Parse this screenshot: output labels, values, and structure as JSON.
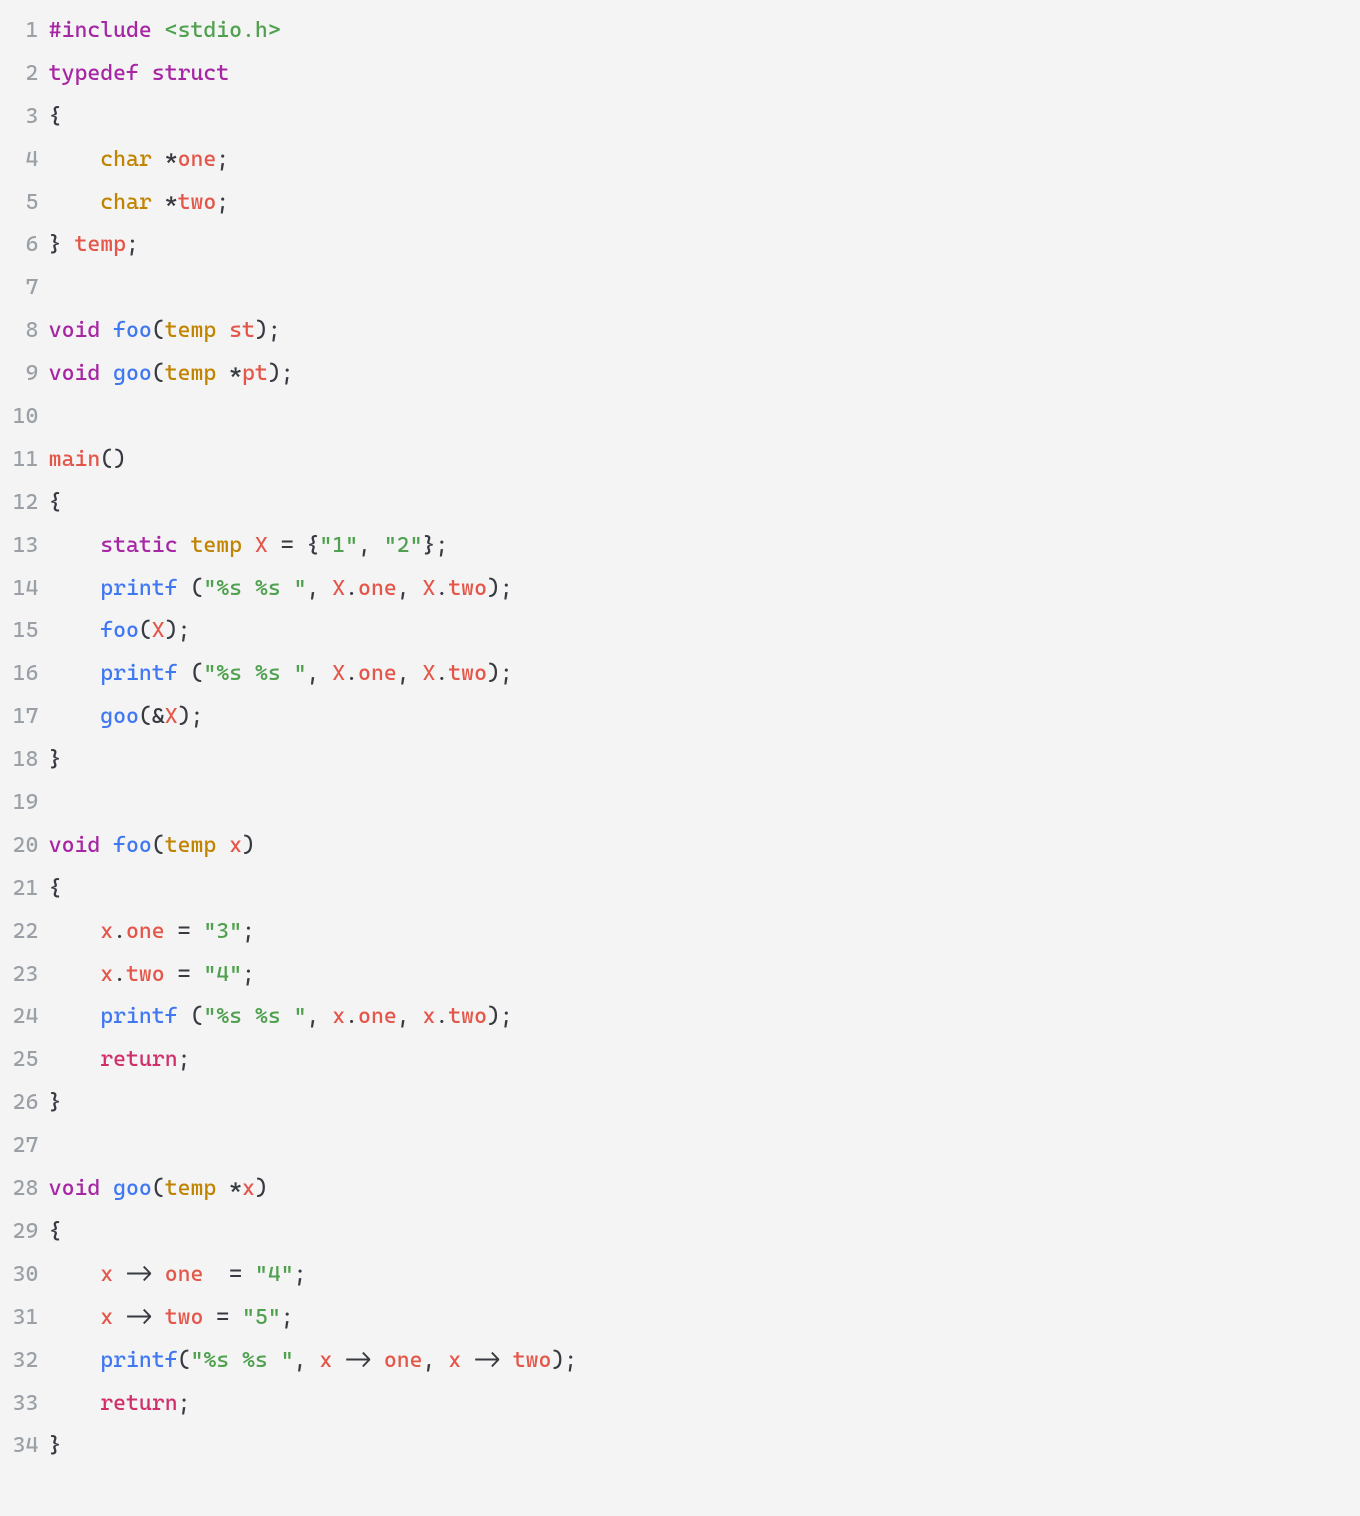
{
  "code": {
    "lines": [
      {
        "n": "1",
        "tokens": [
          {
            "c": "pre",
            "t": "#include "
          },
          {
            "c": "inc",
            "t": "<stdio.h>"
          }
        ]
      },
      {
        "n": "2",
        "tokens": [
          {
            "c": "kw",
            "t": "typedef"
          },
          {
            "c": "txt",
            "t": " "
          },
          {
            "c": "kw",
            "t": "struct"
          }
        ]
      },
      {
        "n": "3",
        "tokens": [
          {
            "c": "pun",
            "t": "{"
          }
        ]
      },
      {
        "n": "4",
        "tokens": [
          {
            "c": "txt",
            "t": "    "
          },
          {
            "c": "type",
            "t": "char"
          },
          {
            "c": "txt",
            "t": " *"
          },
          {
            "c": "name",
            "t": "one"
          },
          {
            "c": "pun",
            "t": ";"
          }
        ]
      },
      {
        "n": "5",
        "tokens": [
          {
            "c": "txt",
            "t": "    "
          },
          {
            "c": "type",
            "t": "char"
          },
          {
            "c": "txt",
            "t": " *"
          },
          {
            "c": "name",
            "t": "two"
          },
          {
            "c": "pun",
            "t": ";"
          }
        ]
      },
      {
        "n": "6",
        "tokens": [
          {
            "c": "pun",
            "t": "} "
          },
          {
            "c": "name",
            "t": "temp"
          },
          {
            "c": "pun",
            "t": ";"
          }
        ]
      },
      {
        "n": "7",
        "tokens": []
      },
      {
        "n": "8",
        "tokens": [
          {
            "c": "kw",
            "t": "void"
          },
          {
            "c": "txt",
            "t": " "
          },
          {
            "c": "func",
            "t": "foo"
          },
          {
            "c": "pun",
            "t": "("
          },
          {
            "c": "type",
            "t": "temp"
          },
          {
            "c": "txt",
            "t": " "
          },
          {
            "c": "name",
            "t": "st"
          },
          {
            "c": "pun",
            "t": ");"
          }
        ]
      },
      {
        "n": "9",
        "tokens": [
          {
            "c": "kw",
            "t": "void"
          },
          {
            "c": "txt",
            "t": " "
          },
          {
            "c": "func",
            "t": "goo"
          },
          {
            "c": "pun",
            "t": "("
          },
          {
            "c": "type",
            "t": "temp"
          },
          {
            "c": "txt",
            "t": " *"
          },
          {
            "c": "name",
            "t": "pt"
          },
          {
            "c": "pun",
            "t": ");"
          }
        ]
      },
      {
        "n": "10",
        "tokens": []
      },
      {
        "n": "11",
        "tokens": [
          {
            "c": "name",
            "t": "main"
          },
          {
            "c": "pun",
            "t": "()"
          }
        ]
      },
      {
        "n": "12",
        "tokens": [
          {
            "c": "pun",
            "t": "{"
          }
        ]
      },
      {
        "n": "13",
        "tokens": [
          {
            "c": "txt",
            "t": "    "
          },
          {
            "c": "kw",
            "t": "static"
          },
          {
            "c": "txt",
            "t": " "
          },
          {
            "c": "type",
            "t": "temp"
          },
          {
            "c": "txt",
            "t": " "
          },
          {
            "c": "name",
            "t": "X"
          },
          {
            "c": "txt",
            "t": " = {"
          },
          {
            "c": "str",
            "t": "\"1\""
          },
          {
            "c": "pun",
            "t": ", "
          },
          {
            "c": "str",
            "t": "\"2\""
          },
          {
            "c": "pun",
            "t": "};"
          }
        ]
      },
      {
        "n": "14",
        "tokens": [
          {
            "c": "txt",
            "t": "    "
          },
          {
            "c": "func",
            "t": "printf"
          },
          {
            "c": "txt",
            "t": " ("
          },
          {
            "c": "str",
            "t": "\"%s %s \""
          },
          {
            "c": "pun",
            "t": ", "
          },
          {
            "c": "name",
            "t": "X"
          },
          {
            "c": "pun",
            "t": "."
          },
          {
            "c": "name",
            "t": "one"
          },
          {
            "c": "pun",
            "t": ", "
          },
          {
            "c": "name",
            "t": "X"
          },
          {
            "c": "pun",
            "t": "."
          },
          {
            "c": "name",
            "t": "two"
          },
          {
            "c": "pun",
            "t": ");"
          }
        ]
      },
      {
        "n": "15",
        "tokens": [
          {
            "c": "txt",
            "t": "    "
          },
          {
            "c": "func",
            "t": "foo"
          },
          {
            "c": "pun",
            "t": "("
          },
          {
            "c": "name",
            "t": "X"
          },
          {
            "c": "pun",
            "t": ");"
          }
        ]
      },
      {
        "n": "16",
        "tokens": [
          {
            "c": "txt",
            "t": "    "
          },
          {
            "c": "func",
            "t": "printf"
          },
          {
            "c": "txt",
            "t": " ("
          },
          {
            "c": "str",
            "t": "\"%s %s \""
          },
          {
            "c": "pun",
            "t": ", "
          },
          {
            "c": "name",
            "t": "X"
          },
          {
            "c": "pun",
            "t": "."
          },
          {
            "c": "name",
            "t": "one"
          },
          {
            "c": "pun",
            "t": ", "
          },
          {
            "c": "name",
            "t": "X"
          },
          {
            "c": "pun",
            "t": "."
          },
          {
            "c": "name",
            "t": "two"
          },
          {
            "c": "pun",
            "t": ");"
          }
        ]
      },
      {
        "n": "17",
        "tokens": [
          {
            "c": "txt",
            "t": "    "
          },
          {
            "c": "func",
            "t": "goo"
          },
          {
            "c": "pun",
            "t": "(&"
          },
          {
            "c": "name",
            "t": "X"
          },
          {
            "c": "pun",
            "t": ");"
          }
        ]
      },
      {
        "n": "18",
        "tokens": [
          {
            "c": "pun",
            "t": "}"
          }
        ]
      },
      {
        "n": "19",
        "tokens": []
      },
      {
        "n": "20",
        "tokens": [
          {
            "c": "kw",
            "t": "void"
          },
          {
            "c": "txt",
            "t": " "
          },
          {
            "c": "func",
            "t": "foo"
          },
          {
            "c": "pun",
            "t": "("
          },
          {
            "c": "type",
            "t": "temp"
          },
          {
            "c": "txt",
            "t": " "
          },
          {
            "c": "name",
            "t": "x"
          },
          {
            "c": "pun",
            "t": ")"
          }
        ]
      },
      {
        "n": "21",
        "tokens": [
          {
            "c": "pun",
            "t": "{"
          }
        ]
      },
      {
        "n": "22",
        "tokens": [
          {
            "c": "txt",
            "t": "    "
          },
          {
            "c": "name",
            "t": "x"
          },
          {
            "c": "pun",
            "t": "."
          },
          {
            "c": "name",
            "t": "one"
          },
          {
            "c": "txt",
            "t": " = "
          },
          {
            "c": "str",
            "t": "\"3\""
          },
          {
            "c": "pun",
            "t": ";"
          }
        ]
      },
      {
        "n": "23",
        "tokens": [
          {
            "c": "txt",
            "t": "    "
          },
          {
            "c": "name",
            "t": "x"
          },
          {
            "c": "pun",
            "t": "."
          },
          {
            "c": "name",
            "t": "two"
          },
          {
            "c": "txt",
            "t": " = "
          },
          {
            "c": "str",
            "t": "\"4\""
          },
          {
            "c": "pun",
            "t": ";"
          }
        ]
      },
      {
        "n": "24",
        "tokens": [
          {
            "c": "txt",
            "t": "    "
          },
          {
            "c": "func",
            "t": "printf"
          },
          {
            "c": "txt",
            "t": " ("
          },
          {
            "c": "str",
            "t": "\"%s %s \""
          },
          {
            "c": "pun",
            "t": ", "
          },
          {
            "c": "name",
            "t": "x"
          },
          {
            "c": "pun",
            "t": "."
          },
          {
            "c": "name",
            "t": "one"
          },
          {
            "c": "pun",
            "t": ", "
          },
          {
            "c": "name",
            "t": "x"
          },
          {
            "c": "pun",
            "t": "."
          },
          {
            "c": "name",
            "t": "two"
          },
          {
            "c": "pun",
            "t": ");"
          }
        ]
      },
      {
        "n": "25",
        "tokens": [
          {
            "c": "txt",
            "t": "    "
          },
          {
            "c": "pink",
            "t": "return"
          },
          {
            "c": "pun",
            "t": ";"
          }
        ]
      },
      {
        "n": "26",
        "tokens": [
          {
            "c": "pun",
            "t": "}"
          }
        ]
      },
      {
        "n": "27",
        "tokens": []
      },
      {
        "n": "28",
        "tokens": [
          {
            "c": "kw",
            "t": "void"
          },
          {
            "c": "txt",
            "t": " "
          },
          {
            "c": "func",
            "t": "goo"
          },
          {
            "c": "pun",
            "t": "("
          },
          {
            "c": "type",
            "t": "temp"
          },
          {
            "c": "txt",
            "t": " *"
          },
          {
            "c": "name",
            "t": "x"
          },
          {
            "c": "pun",
            "t": ")"
          }
        ]
      },
      {
        "n": "29",
        "tokens": [
          {
            "c": "pun",
            "t": "{"
          }
        ]
      },
      {
        "n": "30",
        "tokens": [
          {
            "c": "txt",
            "t": "    "
          },
          {
            "c": "name",
            "t": "x"
          },
          {
            "c": "txt",
            "t": " -> "
          },
          {
            "c": "name",
            "t": "one"
          },
          {
            "c": "txt",
            "t": "  = "
          },
          {
            "c": "str",
            "t": "\"4\""
          },
          {
            "c": "pun",
            "t": ";"
          }
        ]
      },
      {
        "n": "31",
        "tokens": [
          {
            "c": "txt",
            "t": "    "
          },
          {
            "c": "name",
            "t": "x"
          },
          {
            "c": "txt",
            "t": " -> "
          },
          {
            "c": "name",
            "t": "two"
          },
          {
            "c": "txt",
            "t": " = "
          },
          {
            "c": "str",
            "t": "\"5\""
          },
          {
            "c": "pun",
            "t": ";"
          }
        ]
      },
      {
        "n": "32",
        "tokens": [
          {
            "c": "txt",
            "t": "    "
          },
          {
            "c": "func",
            "t": "printf"
          },
          {
            "c": "pun",
            "t": "("
          },
          {
            "c": "str",
            "t": "\"%s %s \""
          },
          {
            "c": "pun",
            "t": ", "
          },
          {
            "c": "name",
            "t": "x"
          },
          {
            "c": "txt",
            "t": " -> "
          },
          {
            "c": "name",
            "t": "one"
          },
          {
            "c": "pun",
            "t": ", "
          },
          {
            "c": "name",
            "t": "x"
          },
          {
            "c": "txt",
            "t": " -> "
          },
          {
            "c": "name",
            "t": "two"
          },
          {
            "c": "pun",
            "t": ");"
          }
        ]
      },
      {
        "n": "33",
        "tokens": [
          {
            "c": "txt",
            "t": "    "
          },
          {
            "c": "pink",
            "t": "return"
          },
          {
            "c": "pun",
            "t": ";"
          }
        ]
      },
      {
        "n": "34",
        "tokens": [
          {
            "c": "pun",
            "t": "}"
          }
        ]
      }
    ]
  }
}
